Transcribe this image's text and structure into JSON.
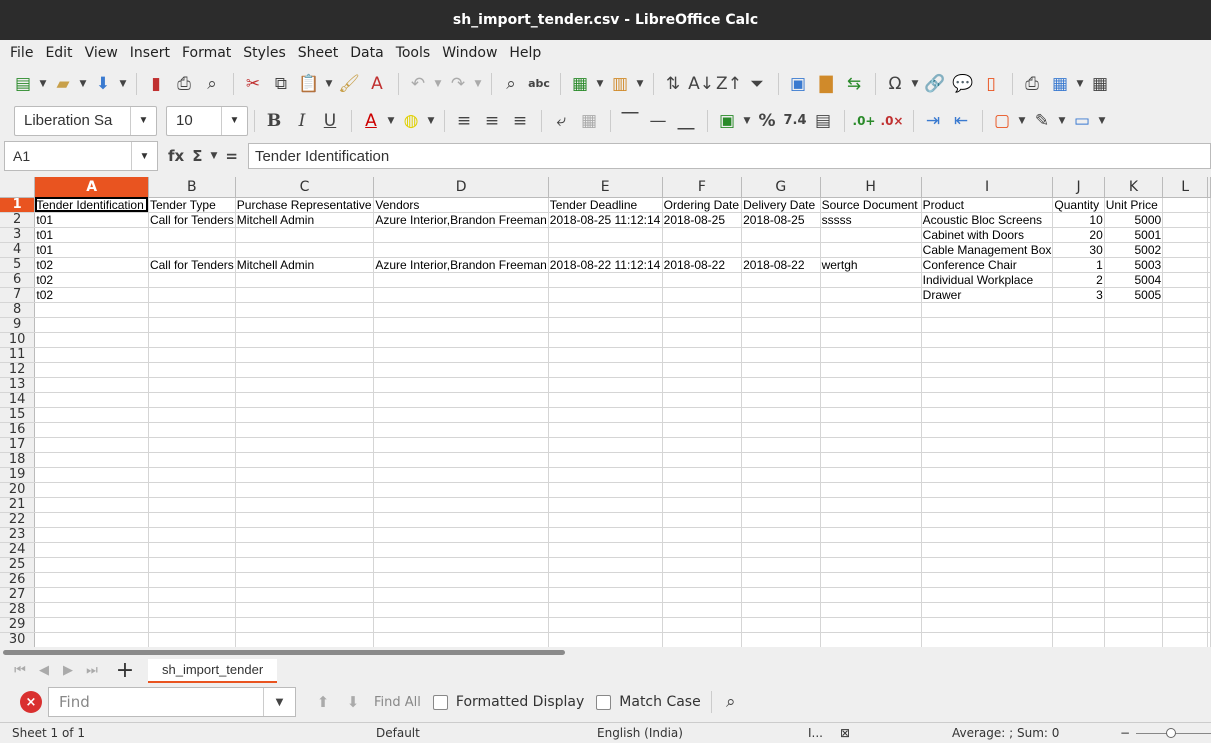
{
  "window": {
    "title": "sh_import_tender.csv - LibreOffice Calc"
  },
  "menu": [
    "File",
    "Edit",
    "View",
    "Insert",
    "Format",
    "Styles",
    "Sheet",
    "Data",
    "Tools",
    "Window",
    "Help"
  ],
  "format_bar": {
    "font_name": "Liberation Sa",
    "font_size": "10",
    "number_format_label": "7.4"
  },
  "formula_bar": {
    "name_box": "A1",
    "fx_label": "fx",
    "sum_label": "Σ",
    "equals_label": "=",
    "content": "Tender Identification"
  },
  "grid": {
    "columns": [
      "A",
      "B",
      "C",
      "D",
      "E",
      "F",
      "G",
      "H",
      "I",
      "J",
      "K",
      "L"
    ],
    "active_column": "A",
    "active_row": 1,
    "rows": [
      [
        "Tender Identification",
        "Tender Type",
        "Purchase Representative",
        "Vendors",
        "Tender Deadline",
        "Ordering Date",
        "Delivery Date",
        "Source Document",
        "Product",
        "Quantity",
        "Unit Price",
        ""
      ],
      [
        "t01",
        "Call for Tenders",
        "Mitchell Admin",
        "Azure Interior,Brandon Freeman",
        "2018-08-25 11:12:14",
        "2018-08-25",
        "2018-08-25",
        "sssss",
        "Acoustic Bloc Screens",
        "10",
        "5000",
        ""
      ],
      [
        "t01",
        "",
        "",
        "",
        "",
        "",
        "",
        "",
        "Cabinet with Doors",
        "20",
        "5001",
        ""
      ],
      [
        "t01",
        "",
        "",
        "",
        "",
        "",
        "",
        "",
        "Cable Management Box",
        "30",
        "5002",
        ""
      ],
      [
        "t02",
        "Call for Tenders",
        "Mitchell Admin",
        "Azure Interior,Brandon Freeman",
        "2018-08-22 11:12:14",
        "2018-08-22",
        "2018-08-22",
        "wertgh",
        "Conference Chair",
        "1",
        "5003",
        ""
      ],
      [
        "t02",
        "",
        "",
        "",
        "",
        "",
        "",
        "",
        "Individual Workplace",
        "2",
        "5004",
        ""
      ],
      [
        "t02",
        "",
        "",
        "",
        "",
        "",
        "",
        "",
        "Drawer",
        "3",
        "5005",
        ""
      ]
    ],
    "total_rows": 30
  },
  "sheet_tabs": [
    "sh_import_tender"
  ],
  "find_bar": {
    "placeholder": "Find",
    "find_all": "Find All",
    "formatted_display": "Formatted Display",
    "match_case": "Match Case"
  },
  "status_bar": {
    "sheet": "Sheet 1 of 1",
    "page_style": "Default",
    "language": "English (India)",
    "selection_mode": "I...",
    "summary": "Average: ; Sum: 0",
    "zoom_minus": "−"
  },
  "colors": {
    "accent": "#e95420",
    "titlebar": "#2c2c2c"
  }
}
